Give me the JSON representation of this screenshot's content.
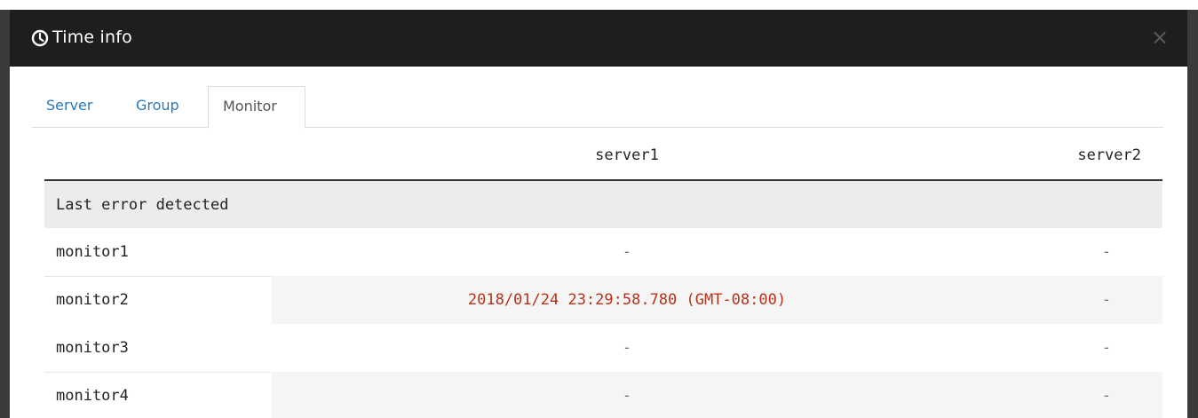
{
  "dialog": {
    "title": "Time info",
    "title_icon": "clock-icon",
    "close_glyph": "×",
    "close_icon": "close-icon"
  },
  "tabs": [
    {
      "label": "Server",
      "active": false
    },
    {
      "label": "Group",
      "active": false
    },
    {
      "label": "Monitor",
      "active": true
    }
  ],
  "table": {
    "columns": [
      "",
      "server1",
      "server2"
    ],
    "section_label": "Last error detected",
    "rows": [
      {
        "name": "monitor1",
        "server1": "-",
        "server2": "-"
      },
      {
        "name": "monitor2",
        "server1": "2018/01/24 23:29:58.780 (GMT-08:00)",
        "server2": "-"
      },
      {
        "name": "monitor3",
        "server1": "-",
        "server2": "-"
      },
      {
        "name": "monitor4",
        "server1": "-",
        "server2": "-"
      }
    ]
  },
  "colors": {
    "header_bg": "#1e1e1e",
    "tab_link": "#2a7ab8",
    "error_text": "#b8321a"
  }
}
